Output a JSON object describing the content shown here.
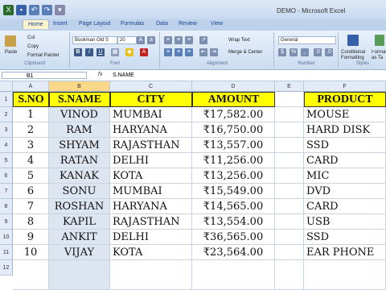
{
  "window": {
    "title": "DEMO - Microsoft Excel"
  },
  "tabs": [
    "Home",
    "Insert",
    "Page Layout",
    "Formulas",
    "Data",
    "Review",
    "View"
  ],
  "ribbon": {
    "clipboard": {
      "paste": "Paste",
      "cut": "Cut",
      "copy": "Copy",
      "format_painter": "Format Painter",
      "label": "Clipboard"
    },
    "font": {
      "name": "Bookman Old S",
      "size": "20",
      "label": "Font"
    },
    "alignment": {
      "wrap": "Wrap Text",
      "merge": "Merge & Center",
      "label": "Alignment"
    },
    "number": {
      "format": "General",
      "label": "Number"
    },
    "styles": {
      "conditional": "Conditional Formatting",
      "format_as": "Format as Ta",
      "label": "Styles"
    }
  },
  "formula_bar": {
    "name_box": "B1",
    "fx": "fx",
    "value": "S.NAME"
  },
  "columns": [
    "A",
    "B",
    "C",
    "D",
    "E",
    "F"
  ],
  "rows": [
    "1",
    "2",
    "3",
    "4",
    "5",
    "6",
    "7",
    "8",
    "9",
    "10",
    "11",
    "12"
  ],
  "table": {
    "headers": {
      "sno": "S.NO",
      "name": "S.NAME",
      "city": "CITY",
      "amount": "AMOUNT",
      "product": "PRODUCT"
    },
    "records": [
      {
        "sno": "1",
        "name": "VINOD",
        "city": "MUMBAI",
        "amount": "₹17,582.00",
        "product": "MOUSE"
      },
      {
        "sno": "2",
        "name": "RAM",
        "city": "HARYANA",
        "amount": "₹16,750.00",
        "product": "HARD DISK"
      },
      {
        "sno": "3",
        "name": "SHYAM",
        "city": "RAJASTHAN",
        "amount": "₹13,557.00",
        "product": "SSD"
      },
      {
        "sno": "4",
        "name": "RATAN",
        "city": "DELHI",
        "amount": "₹11,256.00",
        "product": "CARD"
      },
      {
        "sno": "5",
        "name": "KANAK",
        "city": "KOTA",
        "amount": "₹13,256.00",
        "product": "MIC"
      },
      {
        "sno": "6",
        "name": "SONU",
        "city": "MUMBAI",
        "amount": "₹15,549.00",
        "product": "DVD"
      },
      {
        "sno": "7",
        "name": "ROSHAN",
        "city": "HARYANA",
        "amount": "₹14,565.00",
        "product": "CARD"
      },
      {
        "sno": "8",
        "name": "KAPIL",
        "city": "RAJASTHAN",
        "amount": "₹13,554.00",
        "product": "USB"
      },
      {
        "sno": "9",
        "name": "ANKIT",
        "city": "DELHI",
        "amount": "₹36,565.00",
        "product": "SSD"
      },
      {
        "sno": "10",
        "name": "VIJAY",
        "city": "KOTA",
        "amount": "₹23,564.00",
        "product": "EAR PHONE"
      }
    ]
  }
}
